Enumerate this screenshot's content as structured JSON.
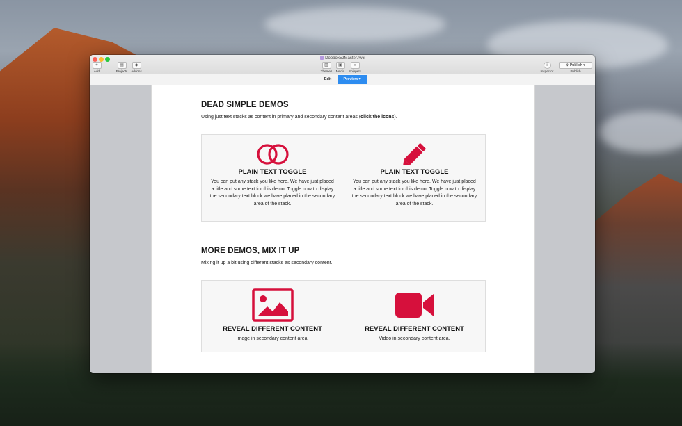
{
  "window": {
    "doc_title": "Doobox52Master.rw6"
  },
  "toolbar": {
    "add": "Add",
    "projects": "Projects",
    "addons": "Addons",
    "themes": "Themes",
    "media": "Media",
    "snippets": "Snippets",
    "inspector": "Inspector",
    "publish_button": "Publish",
    "publish_label": "Publish"
  },
  "modebar": {
    "edit": "Edit",
    "preview": "Preview"
  },
  "section1": {
    "title": "DEAD SIMPLE DEMOS",
    "subtitle_prefix": "Using just text stacks as content in primary and secondary content areas (",
    "subtitle_bold": "click the icons",
    "subtitle_suffix": ").",
    "cards": [
      {
        "icon": "toggle-circles-icon",
        "title": "PLAIN TEXT TOGGLE",
        "text": "You can put any stack you like here. We have just placed a title and some text for this demo. Toggle now to display the secondary text block we have placed in the secondary area of the stack."
      },
      {
        "icon": "pencil-icon",
        "title": "PLAIN TEXT TOGGLE",
        "text": "You can put any stack you like here. We have just placed a title and some text for this demo. Toggle now to display the secondary text block we have placed in the secondary area of the stack."
      }
    ]
  },
  "section2": {
    "title": "MORE DEMOS, MIX IT UP",
    "subtitle": "Mixing it up a bit using different stacks as secondary content.",
    "cards": [
      {
        "icon": "image-icon",
        "title": "REVEAL DIFFERENT CONTENT",
        "text": "Image in secondary content area."
      },
      {
        "icon": "video-camera-icon",
        "title": "REVEAL DIFFERENT CONTENT",
        "text": "Video in secondary content area."
      }
    ]
  },
  "colors": {
    "accent": "#d6103c",
    "preview_blue": "#2d8cf0"
  }
}
